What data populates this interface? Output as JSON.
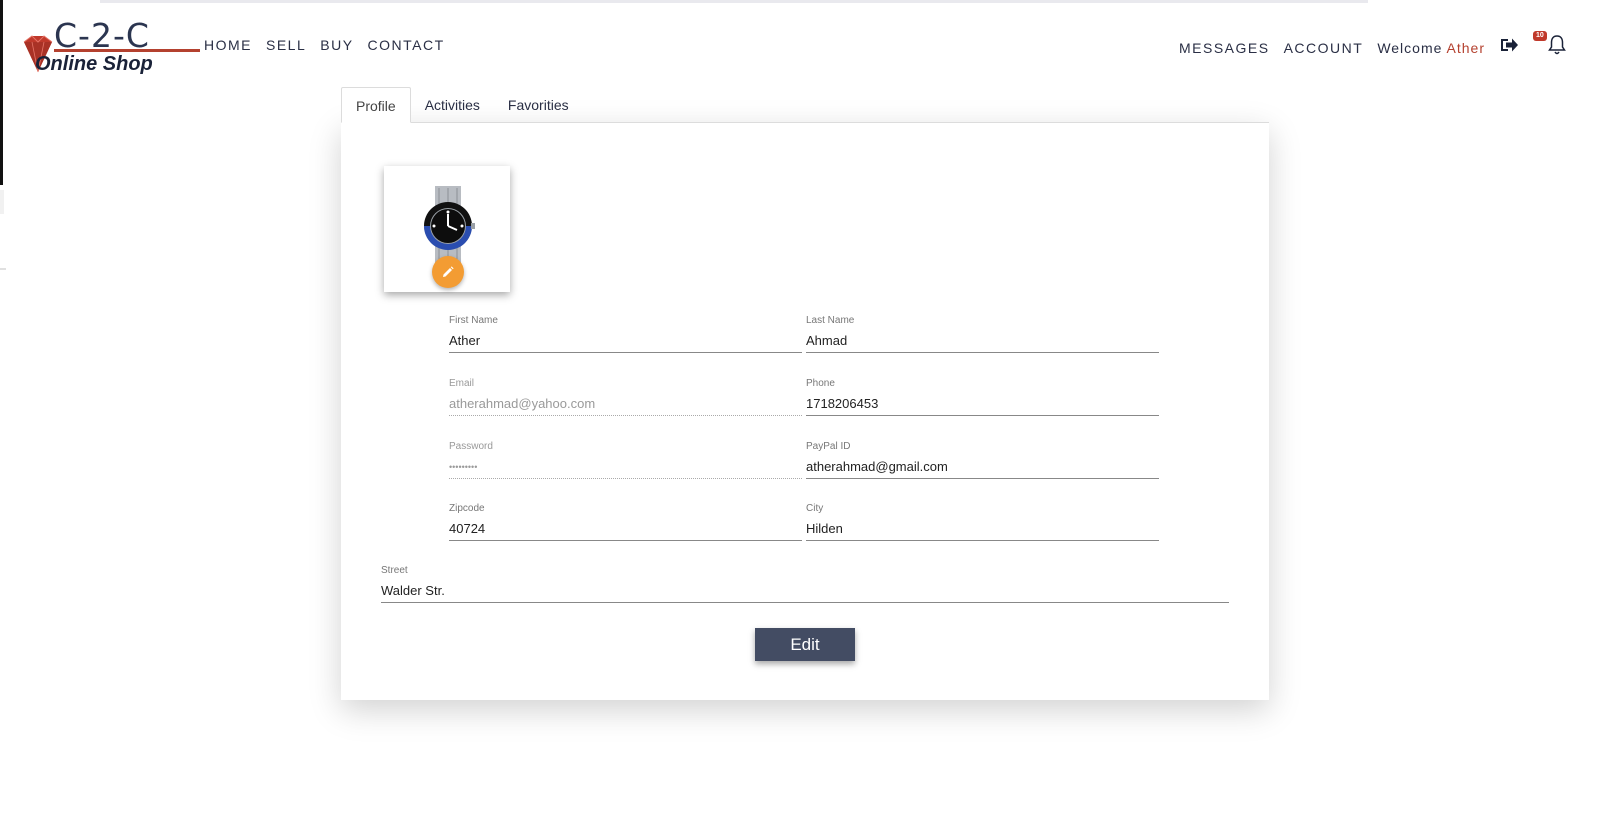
{
  "logo": {
    "line1": "C-2-C",
    "line2": "Online Shop",
    "accent_color": "#b4412f"
  },
  "nav": {
    "left": [
      "HOME",
      "SELL",
      "BUY",
      "CONTACT"
    ],
    "right": [
      "MESSAGES",
      "ACCOUNT"
    ],
    "welcome_label": "Welcome",
    "username": "Ather",
    "notification_count": "10",
    "icons": [
      "sign-out-icon",
      "bell-icon"
    ]
  },
  "tabs": [
    "Profile",
    "Activities",
    "Favorities"
  ],
  "active_tab": "Profile",
  "profile": {
    "first_name": {
      "label": "First Name",
      "value": "Ather"
    },
    "last_name": {
      "label": "Last Name",
      "value": "Ahmad"
    },
    "email": {
      "label": "Email",
      "value": "atherahmad@yahoo.com"
    },
    "phone": {
      "label": "Phone",
      "value": "1718206453"
    },
    "password": {
      "label": "Password",
      "value": "•••••••••"
    },
    "paypal": {
      "label": "PayPal ID",
      "value": "atherahmad@gmail.com"
    },
    "zipcode": {
      "label": "Zipcode",
      "value": "40724"
    },
    "city": {
      "label": "City",
      "value": "Hilden"
    },
    "street": {
      "label": "Street",
      "value": "Walder Str."
    }
  },
  "edit_button": "Edit",
  "colors": {
    "primary_button": "#434c63",
    "photo_edit_button": "#f39c33",
    "badge": "#c0392b"
  }
}
